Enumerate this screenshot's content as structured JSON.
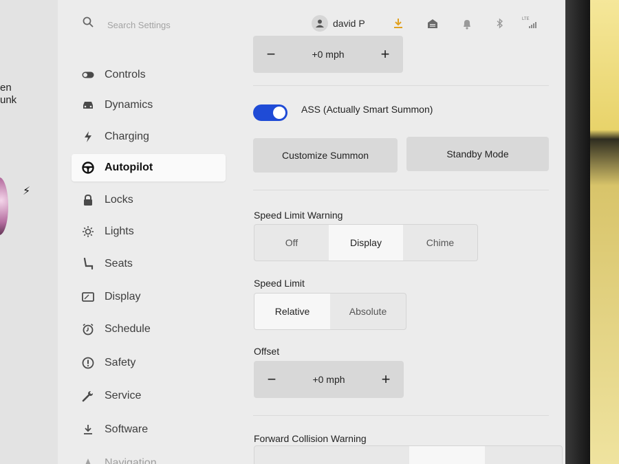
{
  "edge": {
    "line1": "en",
    "line2": "unk"
  },
  "topbar": {
    "search_placeholder": "Search Settings",
    "user_name": "david P",
    "icons": [
      "search-icon",
      "user-icon",
      "download-icon",
      "garage-icon",
      "bell-icon",
      "bluetooth-icon",
      "lte-signal-icon"
    ],
    "lte_label": "LTE",
    "download_color": "#e0a01e"
  },
  "sidebar": {
    "items": [
      {
        "label": "Controls",
        "icon": "toggle-icon"
      },
      {
        "label": "Dynamics",
        "icon": "car-icon"
      },
      {
        "label": "Charging",
        "icon": "bolt-icon"
      },
      {
        "label": "Autopilot",
        "icon": "steering-wheel-icon",
        "active": true
      },
      {
        "label": "Locks",
        "icon": "lock-icon"
      },
      {
        "label": "Lights",
        "icon": "sun-icon"
      },
      {
        "label": "Seats",
        "icon": "seat-icon"
      },
      {
        "label": "Display",
        "icon": "display-icon"
      },
      {
        "label": "Schedule",
        "icon": "clock-icon"
      },
      {
        "label": "Safety",
        "icon": "alert-icon"
      },
      {
        "label": "Service",
        "icon": "wrench-icon"
      },
      {
        "label": "Software",
        "icon": "download-icon"
      },
      {
        "label": "Navigation",
        "icon": "navigation-icon"
      }
    ]
  },
  "main": {
    "top_stepper": {
      "minus": "−",
      "value": "+0 mph",
      "plus": "+"
    },
    "summon_toggle": {
      "label": "ASS (Actually Smart Summon)",
      "on": true,
      "color": "#1f4bd6"
    },
    "customize_summon": "Customize Summon",
    "standby_mode": "Standby Mode",
    "speed_limit_warning": {
      "label": "Speed Limit Warning",
      "options": [
        "Off",
        "Display",
        "Chime"
      ],
      "selected": "Display"
    },
    "speed_limit": {
      "label": "Speed Limit",
      "options": [
        "Relative",
        "Absolute"
      ],
      "selected": "Relative"
    },
    "offset": {
      "label": "Offset",
      "minus": "−",
      "value": "+0 mph",
      "plus": "+"
    },
    "forward_collision_warning": {
      "label": "Forward Collision Warning"
    }
  }
}
